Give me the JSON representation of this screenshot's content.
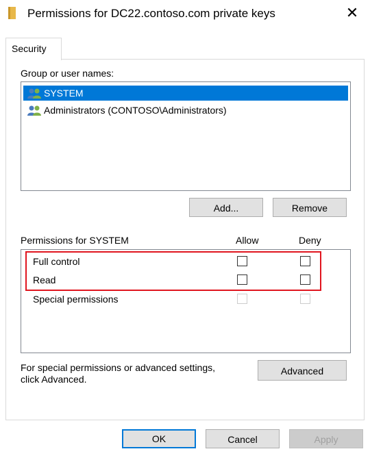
{
  "window": {
    "title": "Permissions for DC22.contoso.com private keys",
    "title_icon": "folder-icon",
    "close_glyph": "✕"
  },
  "tabs": [
    {
      "label": "Security",
      "selected": true
    }
  ],
  "group_section": {
    "label": "Group or user names:",
    "items": [
      {
        "label": "SYSTEM",
        "icon": "users-icon",
        "selected": true
      },
      {
        "label": "Administrators (CONTOSO\\Administrators)",
        "icon": "users-icon",
        "selected": false
      }
    ],
    "add_label": "Add...",
    "remove_label": "Remove"
  },
  "permissions": {
    "header": "Permissions for SYSTEM",
    "allow_header": "Allow",
    "deny_header": "Deny",
    "rows": [
      {
        "label": "Full control",
        "allow": false,
        "deny": false,
        "enabled": true
      },
      {
        "label": "Read",
        "allow": false,
        "deny": false,
        "enabled": true
      },
      {
        "label": "Special permissions",
        "allow": false,
        "deny": false,
        "enabled": false
      }
    ]
  },
  "advanced": {
    "note_line1": "For special permissions or advanced settings,",
    "note_line2": "click Advanced.",
    "button_label": "Advanced"
  },
  "footer": {
    "ok_label": "OK",
    "cancel_label": "Cancel",
    "apply_label": "Apply"
  },
  "colors": {
    "selection": "#0078d7",
    "highlight_frame": "#e0141e",
    "folder": "#e8b84a"
  }
}
